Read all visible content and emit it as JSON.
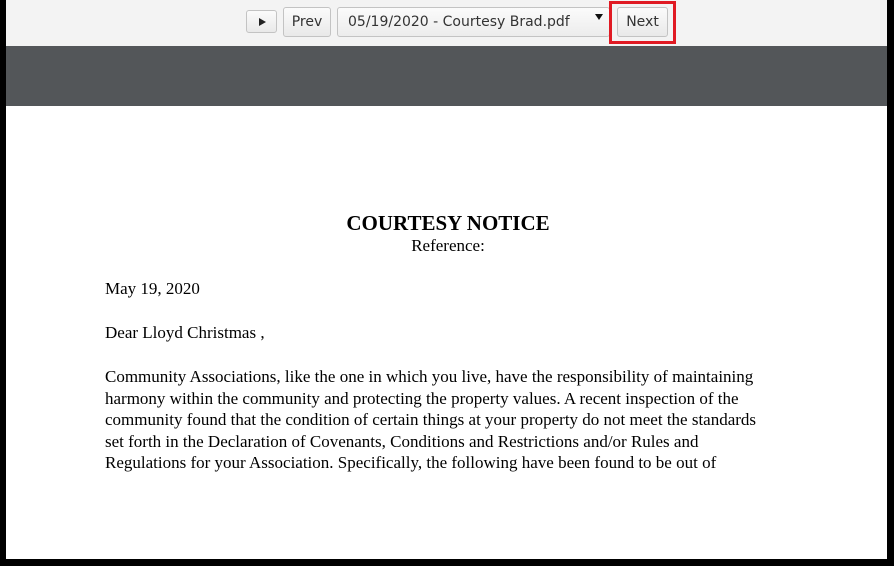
{
  "toolbar": {
    "play_icon": "play-icon",
    "prev_label": "Prev",
    "file_select_value": "05/19/2020 - Courtesy Brad.pdf",
    "next_label": "Next",
    "highlight_color": "#e01a23"
  },
  "document": {
    "title": "COURTESY NOTICE",
    "reference": "Reference:",
    "date": "May 19, 2020",
    "salutation": "Dear Lloyd Christmas ,",
    "body_lines": [
      "Community Associations, like the one in which you live, have the responsibility of maintaining",
      "harmony within the community and protecting the property values. A recent inspection of the",
      "community found that the condition of certain things at your property do not meet the standards",
      "set forth in the Declaration of Covenants, Conditions and Restrictions and/or Rules and",
      "Regulations for your Association. Specifically, the following have been found to be out of"
    ]
  }
}
